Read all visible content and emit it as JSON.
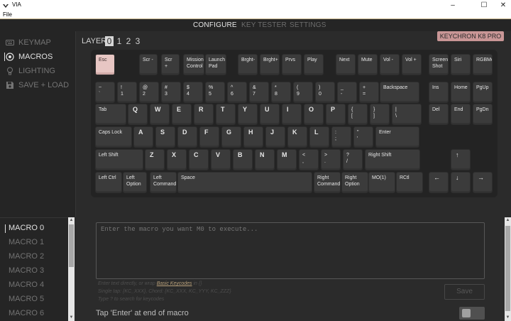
{
  "window": {
    "title": "VIA",
    "minimize": "–",
    "maximize": "☐",
    "close": "✕"
  },
  "menubar": {
    "file": "File"
  },
  "nav": {
    "tabs": [
      "CONFIGURE",
      "KEY TESTER",
      "SETTINGS"
    ],
    "active_tab": "CONFIGURE"
  },
  "sidebar": {
    "items": [
      {
        "label": "KEYMAP",
        "icon": "keyboard-icon",
        "active": false
      },
      {
        "label": "MACROS",
        "icon": "target-icon",
        "active": true
      },
      {
        "label": "LIGHTING",
        "icon": "lightbulb-icon",
        "active": false
      },
      {
        "label": "SAVE + LOAD",
        "icon": "save-icon",
        "active": false
      }
    ]
  },
  "layers": {
    "label": "LAYER",
    "numbers": [
      "0",
      "1",
      "2",
      "3"
    ],
    "selected": "0"
  },
  "keyboard": {
    "name": "KEYCHRON K8 PRO",
    "rows": [
      [
        {
          "l": [
            "Esc"
          ],
          "style": "esc"
        },
        {
          "l": [
            "Scr -"
          ]
        },
        {
          "l": [
            "Scr +"
          ]
        },
        {
          "l": [
            "Mission",
            "Control"
          ]
        },
        {
          "l": [
            "Launch",
            "Pad"
          ]
        },
        {
          "l": [
            "Brght-"
          ]
        },
        {
          "l": [
            "Brght+"
          ]
        },
        {
          "l": [
            "Prvs"
          ]
        },
        {
          "l": [
            "Play"
          ]
        },
        {
          "l": [
            "Next"
          ]
        },
        {
          "l": [
            "Mute"
          ]
        },
        {
          "l": [
            "Vol -"
          ]
        },
        {
          "l": [
            "Vol +"
          ]
        },
        {
          "l": [
            "Screen",
            "Shot"
          ]
        },
        {
          "l": [
            "Siri"
          ]
        },
        {
          "l": [
            "RGBMd+"
          ]
        }
      ],
      [
        {
          "l": [
            "~",
            "`"
          ]
        },
        {
          "l": [
            "!",
            "1"
          ]
        },
        {
          "l": [
            "@",
            "2"
          ]
        },
        {
          "l": [
            "#",
            "3"
          ]
        },
        {
          "l": [
            "$",
            "4"
          ]
        },
        {
          "l": [
            "%",
            "5"
          ]
        },
        {
          "l": [
            "^",
            "6"
          ]
        },
        {
          "l": [
            "&",
            "7"
          ]
        },
        {
          "l": [
            "*",
            "8"
          ]
        },
        {
          "l": [
            "(",
            "9"
          ]
        },
        {
          "l": [
            ")",
            "0"
          ]
        },
        {
          "l": [
            "_",
            "-"
          ]
        },
        {
          "l": [
            "+",
            "="
          ]
        },
        {
          "l": [
            "Backspace"
          ]
        },
        {
          "l": [
            "Ins"
          ]
        },
        {
          "l": [
            "Home"
          ]
        },
        {
          "l": [
            "PgUp"
          ]
        }
      ],
      [
        {
          "l": [
            "Tab"
          ]
        },
        {
          "l": [
            "Q"
          ]
        },
        {
          "l": [
            "W"
          ]
        },
        {
          "l": [
            "E"
          ]
        },
        {
          "l": [
            "R"
          ]
        },
        {
          "l": [
            "T"
          ]
        },
        {
          "l": [
            "Y"
          ]
        },
        {
          "l": [
            "U"
          ]
        },
        {
          "l": [
            "I"
          ]
        },
        {
          "l": [
            "O"
          ]
        },
        {
          "l": [
            "P"
          ]
        },
        {
          "l": [
            "{",
            "["
          ]
        },
        {
          "l": [
            "}",
            "]"
          ]
        },
        {
          "l": [
            "|",
            "\\"
          ]
        },
        {
          "l": [
            "Del"
          ]
        },
        {
          "l": [
            "End"
          ]
        },
        {
          "l": [
            "PgDn"
          ]
        }
      ],
      [
        {
          "l": [
            "Caps Lock"
          ]
        },
        {
          "l": [
            "A"
          ]
        },
        {
          "l": [
            "S"
          ]
        },
        {
          "l": [
            "D"
          ]
        },
        {
          "l": [
            "F"
          ]
        },
        {
          "l": [
            "G"
          ]
        },
        {
          "l": [
            "H"
          ]
        },
        {
          "l": [
            "J"
          ]
        },
        {
          "l": [
            "K"
          ]
        },
        {
          "l": [
            "L"
          ]
        },
        {
          "l": [
            ":",
            ";"
          ]
        },
        {
          "l": [
            "\"",
            "'"
          ]
        },
        {
          "l": [
            "Enter"
          ]
        }
      ],
      [
        {
          "l": [
            "Left Shift"
          ]
        },
        {
          "l": [
            "Z"
          ]
        },
        {
          "l": [
            "X"
          ]
        },
        {
          "l": [
            "C"
          ]
        },
        {
          "l": [
            "V"
          ]
        },
        {
          "l": [
            "B"
          ]
        },
        {
          "l": [
            "N"
          ]
        },
        {
          "l": [
            "M"
          ]
        },
        {
          "l": [
            "<",
            ","
          ]
        },
        {
          "l": [
            ">",
            "."
          ]
        },
        {
          "l": [
            "?",
            "/"
          ]
        },
        {
          "l": [
            "Right Shift"
          ]
        },
        {
          "l": [
            "↑"
          ]
        }
      ],
      [
        {
          "l": [
            "Left Ctrl"
          ]
        },
        {
          "l": [
            "Left",
            "Option"
          ]
        },
        {
          "l": [
            "Left",
            "Command"
          ]
        },
        {
          "l": [
            "Space"
          ]
        },
        {
          "l": [
            "Right",
            "Command"
          ]
        },
        {
          "l": [
            "Right",
            "Option"
          ]
        },
        {
          "l": [
            "MO(1)"
          ]
        },
        {
          "l": [
            "RCtl"
          ]
        },
        {
          "l": [
            "←"
          ]
        },
        {
          "l": [
            "↓"
          ]
        },
        {
          "l": [
            "→"
          ]
        }
      ]
    ]
  },
  "macros": {
    "items": [
      "MACRO 0",
      "MACRO 1",
      "MACRO 2",
      "MACRO 3",
      "MACRO 4",
      "MACRO 5",
      "MACRO 6"
    ],
    "selected": "MACRO 0",
    "placeholder": "Enter the macro you want M0 to execute...",
    "hint_line1_pre": "Enter text directly, or wrap ",
    "hint_line1_link": "Basic Keycodes",
    "hint_line1_post": " in {}",
    "hint_line2": "Single tap: {KC_XXX}, Chord: {KC_XXX, KC_YYY, KC_ZZZ}",
    "hint_line3": "Type ? to search for keycodes",
    "save_label": "Save",
    "tap_enter_label": "Tap 'Enter' at end of macro",
    "tap_enter_on": false
  },
  "colors": {
    "accent_pink": "#c99696",
    "esc_key": "#e7c6c3",
    "link": "#b8a07a"
  }
}
